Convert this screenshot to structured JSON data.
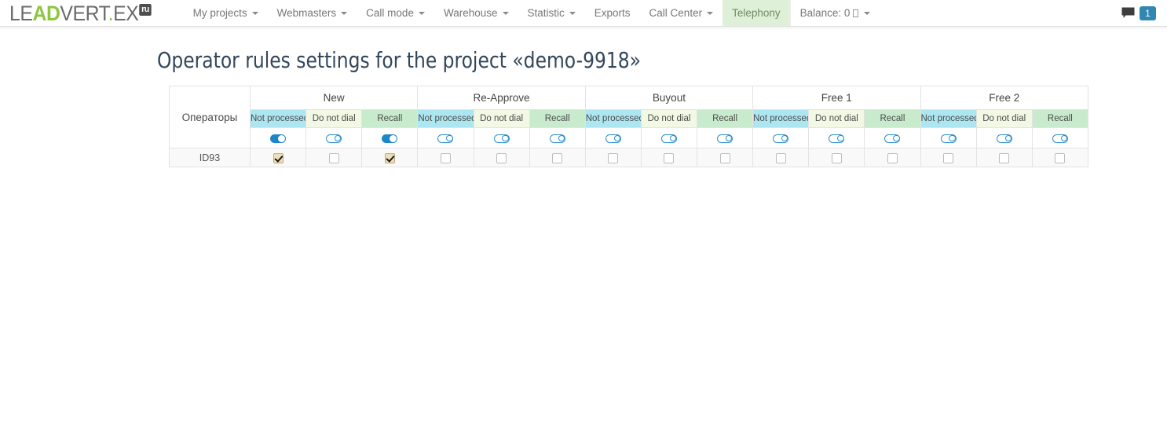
{
  "navbar": {
    "brand": {
      "part1": "LE",
      "part2": "AD",
      "part3": "VERT",
      "dot": ".",
      "part4": "EX",
      "badge": "ru"
    },
    "items": [
      {
        "label": "My projects",
        "caret": true,
        "active": false,
        "separator": false
      },
      {
        "label": "Webmasters",
        "caret": true,
        "active": false,
        "separator": false
      },
      {
        "label": "Call mode",
        "caret": true,
        "active": false,
        "separator": false
      },
      {
        "label": "Warehouse",
        "caret": true,
        "active": false,
        "separator": false
      },
      {
        "label": "Statistic",
        "caret": true,
        "active": false,
        "separator": false
      },
      {
        "label": "Exports",
        "caret": false,
        "active": false,
        "separator": false
      },
      {
        "label": "Call Center",
        "caret": true,
        "active": false,
        "separator": false
      },
      {
        "label": "Telephony",
        "caret": false,
        "active": true,
        "separator": false
      }
    ],
    "balance": {
      "label": "Balance: 0",
      "currency_glyph": "missing-glyph-box",
      "caret": true
    },
    "right": {
      "comment_icon": "comment-icon",
      "notification_count": "1",
      "badge_color": "#2f87b2"
    }
  },
  "page": {
    "title": "Operator rules settings for the project «demo-9918»"
  },
  "table": {
    "operators_header": "Операторы",
    "groups": [
      {
        "name": "New"
      },
      {
        "name": "Re-Approve"
      },
      {
        "name": "Buyout"
      },
      {
        "name": "Free 1"
      },
      {
        "name": "Free 2"
      }
    ],
    "sub_headers": [
      "Not processed",
      "Do not dial",
      "Recall"
    ],
    "sub_header_colors": {
      "Not processed": "#ace6f0",
      "Do not dial": "#f1f8e4",
      "Recall": "#c9ebcd"
    },
    "toggle_row": [
      {
        "group": "New",
        "values": [
          "on",
          "off",
          "on"
        ]
      },
      {
        "group": "Re-Approve",
        "values": [
          "off",
          "off",
          "off"
        ]
      },
      {
        "group": "Buyout",
        "values": [
          "off",
          "off",
          "off"
        ]
      },
      {
        "group": "Free 1",
        "values": [
          "off",
          "off",
          "off"
        ]
      },
      {
        "group": "Free 2",
        "values": [
          "off",
          "off",
          "off"
        ]
      }
    ],
    "rows": [
      {
        "operator_id": "ID93",
        "checks": [
          {
            "group": "New",
            "values": [
              "checked",
              "unchecked",
              "checked"
            ]
          },
          {
            "group": "Re-Approve",
            "values": [
              "unchecked",
              "unchecked",
              "unchecked"
            ]
          },
          {
            "group": "Buyout",
            "values": [
              "unchecked",
              "unchecked",
              "unchecked"
            ]
          },
          {
            "group": "Free 1",
            "values": [
              "unchecked",
              "unchecked",
              "unchecked"
            ]
          },
          {
            "group": "Free 2",
            "values": [
              "unchecked",
              "unchecked",
              "unchecked"
            ]
          }
        ]
      }
    ]
  }
}
